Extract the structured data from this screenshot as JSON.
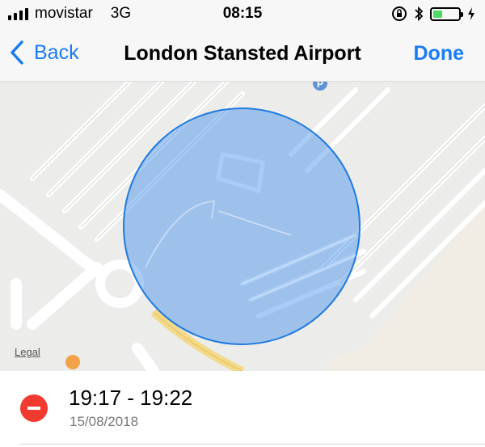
{
  "status_bar": {
    "carrier": "movistar",
    "network": "3G",
    "time": "08:15",
    "signal_bars": 4,
    "battery_level": 0.35,
    "battery_color": "#4cd964",
    "icons": [
      "orientation-lock-icon",
      "bluetooth-icon",
      "battery-icon",
      "charging-icon"
    ]
  },
  "nav": {
    "back_label": "Back",
    "title": "London Stansted Airport",
    "done_label": "Done",
    "accent_color": "#1a7cf5"
  },
  "map": {
    "legal_label": "Legal",
    "region_color": "#2f86ea",
    "poi_icons": [
      "parking-icon",
      "restaurant-icon"
    ]
  },
  "entry": {
    "time_range": "19:17 - 19:22",
    "date": "15/08/2018",
    "delete_color": "#f23b30"
  }
}
